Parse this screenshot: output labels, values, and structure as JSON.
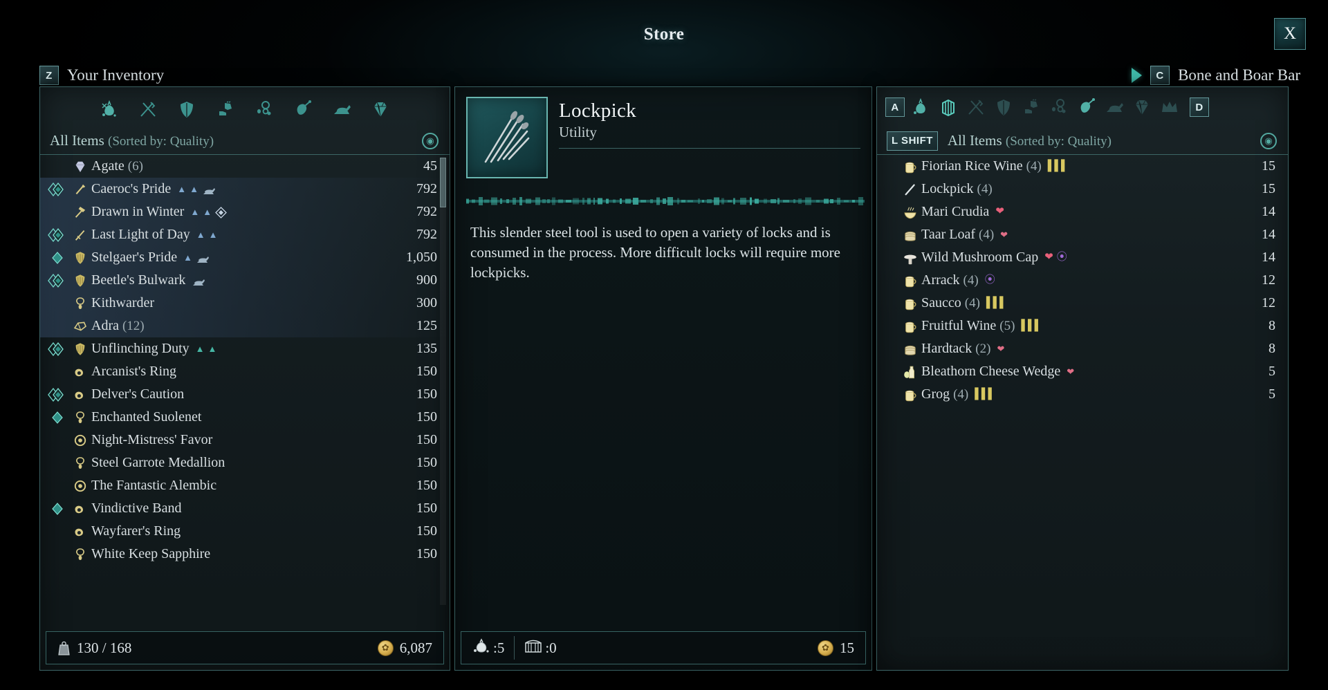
{
  "window": {
    "title": "Store",
    "close_label": "X"
  },
  "left_header": {
    "key": "Z",
    "label": "Your Inventory"
  },
  "right_header": {
    "key": "C",
    "label": "Bone and Boar Bar",
    "arrow_icon": "arrow-right-icon"
  },
  "left_panel": {
    "categories": [
      {
        "name": "all-items-icon"
      },
      {
        "name": "weapons-icon"
      },
      {
        "name": "armor-icon"
      },
      {
        "name": "boots-gloves-icon"
      },
      {
        "name": "trinkets-icon"
      },
      {
        "name": "food-icon"
      },
      {
        "name": "crafting-icon"
      },
      {
        "name": "gems-icon"
      }
    ],
    "sort_label": "All Items",
    "sort_sub": "(Sorted by: Quality)",
    "sort_icon": "sort-quality-icon",
    "items": [
      {
        "quality": "none",
        "icon": "gem-icon",
        "name": "Agate",
        "count": "(6)",
        "mods": [],
        "price": "45",
        "highlight": false
      },
      {
        "quality": "double",
        "icon": "weapon-icon",
        "name": "Caeroc's Pride",
        "count": "",
        "mods": [
          "chev",
          "chev",
          "anvil"
        ],
        "price": "792",
        "highlight": true
      },
      {
        "quality": "none",
        "icon": "hammer-icon",
        "name": "Drawn in Winter",
        "count": "",
        "mods": [
          "chev",
          "chev",
          "gem"
        ],
        "price": "792",
        "highlight": true
      },
      {
        "quality": "double",
        "icon": "sword-icon",
        "name": "Last Light of Day",
        "count": "",
        "mods": [
          "chev",
          "chev"
        ],
        "price": "792",
        "highlight": true
      },
      {
        "quality": "single",
        "icon": "shield-icon",
        "name": "Stelgaer's Pride",
        "count": "",
        "mods": [
          "chev",
          "anvil"
        ],
        "price": "1,050",
        "highlight": true
      },
      {
        "quality": "double",
        "icon": "shield-icon",
        "name": "Beetle's Bulwark",
        "count": "",
        "mods": [
          "anvil"
        ],
        "price": "900",
        "highlight": true
      },
      {
        "quality": "none",
        "icon": "amulet-icon",
        "name": "Kithwarder",
        "count": "",
        "mods": [],
        "price": "300",
        "highlight": true
      },
      {
        "quality": "none",
        "icon": "adra-icon",
        "name": "Adra",
        "count": "(12)",
        "mods": [],
        "price": "125",
        "highlight": true
      },
      {
        "quality": "double",
        "icon": "shield-icon",
        "name": "Unflinching Duty",
        "count": "",
        "mods": [
          "tchev",
          "tchev"
        ],
        "price": "135",
        "highlight": false
      },
      {
        "quality": "none",
        "icon": "ring-icon",
        "name": "Arcanist's Ring",
        "count": "",
        "mods": [],
        "price": "150",
        "highlight": false
      },
      {
        "quality": "double",
        "icon": "ring-icon",
        "name": "Delver's Caution",
        "count": "",
        "mods": [],
        "price": "150",
        "highlight": false
      },
      {
        "quality": "single",
        "icon": "amulet-icon",
        "name": "Enchanted Suolenet",
        "count": "",
        "mods": [],
        "price": "150",
        "highlight": false
      },
      {
        "quality": "none",
        "icon": "medal-icon",
        "name": "Night-Mistress' Favor",
        "count": "",
        "mods": [],
        "price": "150",
        "highlight": false
      },
      {
        "quality": "none",
        "icon": "amulet-icon",
        "name": "Steel Garrote Medallion",
        "count": "",
        "mods": [],
        "price": "150",
        "highlight": false
      },
      {
        "quality": "none",
        "icon": "medal-icon",
        "name": "The Fantastic Alembic",
        "count": "",
        "mods": [],
        "price": "150",
        "highlight": false
      },
      {
        "quality": "single",
        "icon": "ring-icon",
        "name": "Vindictive Band",
        "count": "",
        "mods": [],
        "price": "150",
        "highlight": false
      },
      {
        "quality": "none",
        "icon": "ring-icon",
        "name": "Wayfarer's Ring",
        "count": "",
        "mods": [],
        "price": "150",
        "highlight": false
      },
      {
        "quality": "none",
        "icon": "amulet-icon",
        "name": "White Keep Sapphire",
        "count": "",
        "mods": [],
        "price": "150",
        "highlight": false
      }
    ],
    "footer": {
      "weight_icon": "weight-icon",
      "weight": "130 / 168",
      "coin_icon": "coin-icon",
      "currency": "6,087"
    }
  },
  "center_panel": {
    "item_icon": "lockpick-icon",
    "name": "Lockpick",
    "type": "Utility",
    "description": "This slender steel tool is used to open a variety of locks and is consumed in the process. More difficult locks will require more lockpicks.",
    "footer": {
      "bag_icon": "coin-pouch-icon",
      "bag_value": ":5",
      "chest_icon": "chest-icon",
      "chest_value": ":0",
      "coin_icon": "coin-icon",
      "total": "15"
    }
  },
  "right_panel": {
    "key_left": "A",
    "key_right": "D",
    "categories": [
      {
        "name": "coin-pouch-icon"
      },
      {
        "name": "all-items-icon"
      },
      {
        "name": "weapons-icon"
      },
      {
        "name": "armor-icon"
      },
      {
        "name": "boots-gloves-icon"
      },
      {
        "name": "trinkets-icon"
      },
      {
        "name": "food-icon"
      },
      {
        "name": "crafting-icon"
      },
      {
        "name": "gems-icon"
      },
      {
        "name": "crown-icon"
      }
    ],
    "shift_key": "L SHIFT",
    "sort_label": "All Items",
    "sort_sub": "(Sorted by: Quality)",
    "sort_icon": "sort-quality-icon",
    "items": [
      {
        "icon": "mug-icon",
        "name": "Fiorian Rice Wine",
        "count": "(4)",
        "mods": [
          "bars"
        ],
        "price": "15"
      },
      {
        "icon": "lockpick-icon",
        "name": "Lockpick",
        "count": "(4)",
        "mods": [],
        "price": "15"
      },
      {
        "icon": "bowl-icon",
        "name": "Mari Crudia",
        "count": "",
        "mods": [
          "heart"
        ],
        "price": "14"
      },
      {
        "icon": "bread-icon",
        "name": "Taar Loaf",
        "count": "(4)",
        "mods": [
          "heart-sm"
        ],
        "price": "14"
      },
      {
        "icon": "mushroom-icon",
        "name": "Wild Mushroom Cap",
        "count": "",
        "mods": [
          "heart",
          "swirl"
        ],
        "price": "14"
      },
      {
        "icon": "mug-icon",
        "name": "Arrack",
        "count": "(4)",
        "mods": [
          "swirl"
        ],
        "price": "12"
      },
      {
        "icon": "mug-icon",
        "name": "Saucco",
        "count": "(4)",
        "mods": [
          "bars"
        ],
        "price": "12"
      },
      {
        "icon": "mug-icon",
        "name": "Fruitful Wine",
        "count": "(5)",
        "mods": [
          "bars"
        ],
        "price": "8"
      },
      {
        "icon": "bread-icon",
        "name": "Hardtack",
        "count": "(2)",
        "mods": [
          "heart-sm"
        ],
        "price": "8"
      },
      {
        "icon": "cheese-icon",
        "name": "Bleathorn Cheese Wedge",
        "count": "",
        "mods": [
          "heart-sm"
        ],
        "price": "5"
      },
      {
        "icon": "mug-icon",
        "name": "Grog",
        "count": "(4)",
        "mods": [
          "bars"
        ],
        "price": "5"
      }
    ]
  },
  "colors": {
    "accent_teal": "#4fa89f",
    "panel_border": "#5c9e9e",
    "text_primary": "#dbe2e5",
    "gold": "#d6ae4e",
    "heart_red": "#e8607a",
    "bars_yellow": "#d8c860",
    "swirl_purple": "#a06ad8"
  }
}
